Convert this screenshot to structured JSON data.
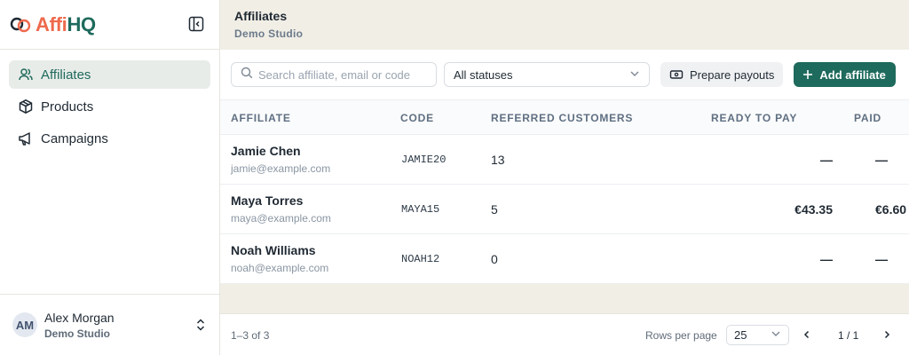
{
  "brand": {
    "name_part1": "Affi",
    "name_part2": "HQ"
  },
  "sidebar": {
    "items": [
      {
        "label": "Affiliates",
        "icon": "users-icon",
        "active": true
      },
      {
        "label": "Products",
        "icon": "box-icon",
        "active": false
      },
      {
        "label": "Campaigns",
        "icon": "megaphone-icon",
        "active": false
      }
    ],
    "user": {
      "initials": "AM",
      "name": "Alex Morgan",
      "org": "Demo Studio"
    }
  },
  "header": {
    "title": "Affiliates",
    "subtitle": "Demo Studio"
  },
  "toolbar": {
    "search_placeholder": "Search affiliate, email or code",
    "status_value": "All statuses",
    "payouts_label": "Prepare payouts",
    "add_label": "Add affiliate"
  },
  "table": {
    "columns": [
      "AFFILIATE",
      "CODE",
      "REFERRED CUSTOMERS",
      "READY TO PAY",
      "PAID"
    ],
    "rows": [
      {
        "name": "Jamie Chen",
        "email": "jamie@example.com",
        "code": "JAMIE20",
        "referred": "13",
        "ready": "—",
        "paid": "—"
      },
      {
        "name": "Maya Torres",
        "email": "maya@example.com",
        "code": "MAYA15",
        "referred": "5",
        "ready": "€43.35",
        "paid": "€6.60"
      },
      {
        "name": "Noah Williams",
        "email": "noah@example.com",
        "code": "NOAH12",
        "referred": "0",
        "ready": "—",
        "paid": "—"
      }
    ]
  },
  "footer": {
    "range": "1–3 of 3",
    "rows_per_page_label": "Rows per page",
    "rows_per_page": "25",
    "page": "1 / 1"
  },
  "colors": {
    "accent": "#1e6a5c",
    "brand_orange": "#ee6a4d",
    "header_bg": "#f1eee6"
  }
}
